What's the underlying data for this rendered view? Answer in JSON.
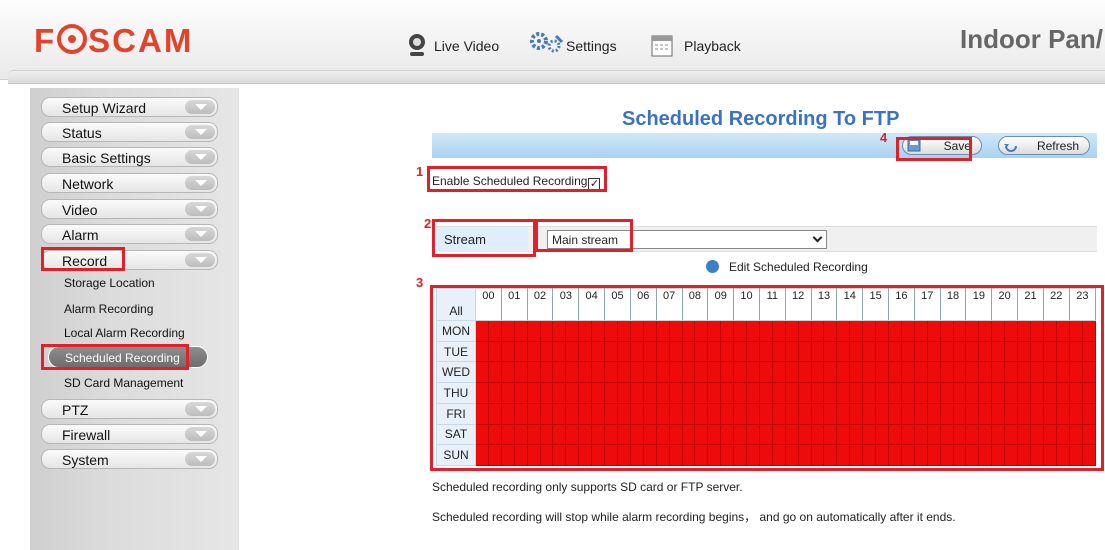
{
  "header": {
    "logo": "FOSCAM",
    "product_title": "Indoor Pan/",
    "tabs": [
      {
        "label": "Live Video",
        "icon": "webcam-icon"
      },
      {
        "label": "Settings",
        "icon": "gears-icon"
      },
      {
        "label": "Playback",
        "icon": "calendar-icon"
      }
    ]
  },
  "sidebar": {
    "items": [
      {
        "label": "Setup Wizard"
      },
      {
        "label": "Status"
      },
      {
        "label": "Basic Settings"
      },
      {
        "label": "Network"
      },
      {
        "label": "Video"
      },
      {
        "label": "Alarm"
      },
      {
        "label": "Record"
      },
      {
        "label": "PTZ"
      },
      {
        "label": "Firewall"
      },
      {
        "label": "System"
      }
    ],
    "record_sub": [
      {
        "label": "Storage Location"
      },
      {
        "label": "Alarm Recording"
      },
      {
        "label": "Local Alarm Recording"
      },
      {
        "label": "Scheduled Recording"
      },
      {
        "label": "SD Card Management"
      }
    ]
  },
  "page": {
    "title": "Scheduled Recording To FTP",
    "save_label": "Save",
    "refresh_label": "Refresh",
    "enable_label": "Enable Scheduled Recording",
    "enable_checked": "✓",
    "stream_label": "Stream",
    "stream_value": "Main stream",
    "edit_label": "Edit Scheduled Recording",
    "notes": [
      "Scheduled recording only supports SD card or FTP server.",
      "Scheduled recording will stop while alarm recording begins， and go on automatically after it ends."
    ]
  },
  "annotations": [
    "1",
    "2",
    "3",
    "4"
  ],
  "schedule": {
    "all_label": "All",
    "days": [
      "MON",
      "TUE",
      "WED",
      "THU",
      "FRI",
      "SAT",
      "SUN"
    ],
    "hours": [
      "00",
      "01",
      "02",
      "03",
      "04",
      "05",
      "06",
      "07",
      "08",
      "09",
      "10",
      "11",
      "12",
      "13",
      "14",
      "15",
      "16",
      "17",
      "18",
      "19",
      "20",
      "21",
      "22",
      "23"
    ],
    "slots_per_hour": 2,
    "all_slots_selected": true,
    "selected_color": "#ee0b0b"
  },
  "colors": {
    "logo": "#e0452c",
    "title": "#3b73c4",
    "highlight": "#e0202a",
    "toolbar": "#a9d2f0"
  }
}
